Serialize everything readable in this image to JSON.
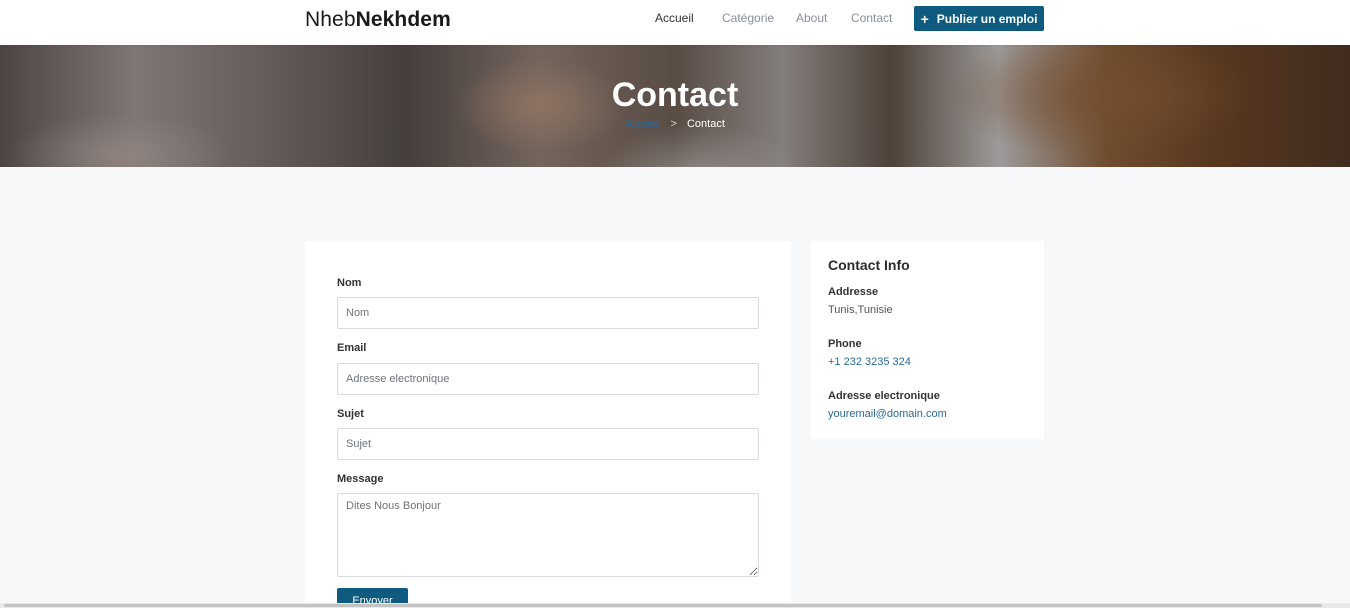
{
  "header": {
    "logo_light": "Nheb",
    "logo_bold": "Nekhdem",
    "nav": [
      {
        "label": "Accueil"
      },
      {
        "label": "Catégorie"
      },
      {
        "label": "About"
      },
      {
        "label": "Contact"
      }
    ],
    "post_button": {
      "icon": "plus-icon",
      "label": "Publier un emploi"
    }
  },
  "hero": {
    "title": "Contact",
    "breadcrumb": {
      "home": "Accueil",
      "separator": ">",
      "current": "Contact"
    }
  },
  "form": {
    "name": {
      "label": "Nom",
      "placeholder": "Nom"
    },
    "email": {
      "label": "Email",
      "placeholder": "Adresse electronique"
    },
    "subject": {
      "label": "Sujet",
      "placeholder": "Sujet"
    },
    "message": {
      "label": "Message",
      "placeholder": "Dites Nous Bonjour"
    },
    "submit_label": "Envoyer"
  },
  "contact_info": {
    "title": "Contact Info",
    "address_label": "Addresse",
    "address_value": "Tunis,Tunisie",
    "phone_label": "Phone",
    "phone_value": "+1 232 3235 324",
    "email_label": "Adresse electronique",
    "email_value": "youremail@domain.com"
  },
  "colors": {
    "accent": "#0e5b7f",
    "link": "#2a6a9a",
    "page_bg": "#f7f8fa"
  }
}
